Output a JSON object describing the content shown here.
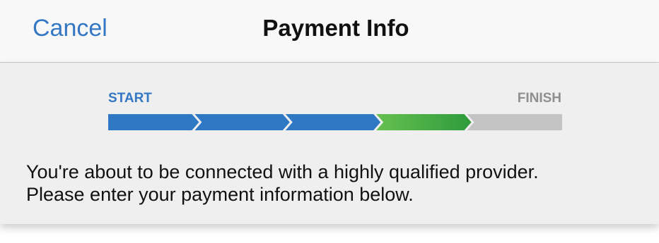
{
  "navbar": {
    "cancel_label": "Cancel",
    "title": "Payment Info"
  },
  "progress": {
    "start_label": "START",
    "finish_label": "FINISH",
    "total_steps": 5,
    "completed_steps": 3,
    "current_step": 4,
    "colors": {
      "completed": "#2f78c4",
      "current_start": "#66c050",
      "current_end": "#2e9b3c",
      "pending": "#c4c4c4"
    }
  },
  "message": {
    "line1": "You're about to be connected with a highly qualified provider.",
    "line2": "Please enter your payment information below."
  }
}
